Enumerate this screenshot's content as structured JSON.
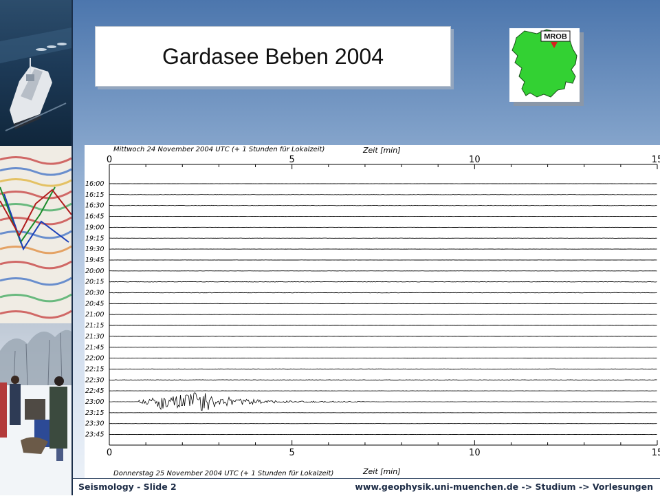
{
  "slide": {
    "title": "Gardasee Beben 2004",
    "footer_left": "Seismology - Slide 2",
    "footer_right": "www.geophysik.uni-muenchen.de -> Studium -> Vorlesungen"
  },
  "map": {
    "station_label": "MROB",
    "region_color": "#33d133",
    "marker_color": "#d71f1f"
  },
  "chart_data": {
    "type": "line",
    "top_caption": "Mittwoch 24 November 2004 UTC (+ 1 Stunden für Lokalzeit)",
    "bottom_caption": "Donnerstag 25 November 2004 UTC (+ 1 Stunden für Lokalzeit)",
    "xlabel": "Zeit [min]",
    "xlim": [
      0,
      15
    ],
    "xticks": [
      "0",
      "5",
      "10",
      "15"
    ],
    "rows": [
      "16:00",
      "16:15",
      "16:30",
      "16:45",
      "19:00",
      "19:15",
      "19:30",
      "19:45",
      "20:00",
      "20:15",
      "20:30",
      "20:45",
      "21:00",
      "21:15",
      "21:30",
      "21:45",
      "22:00",
      "22:15",
      "22:30",
      "22:45",
      "23:00",
      "23:15",
      "23:30",
      "23:45"
    ],
    "event": {
      "row": "23:00",
      "start_min": 0.8,
      "peak_min": 2.4,
      "end_min": 7.0
    }
  }
}
